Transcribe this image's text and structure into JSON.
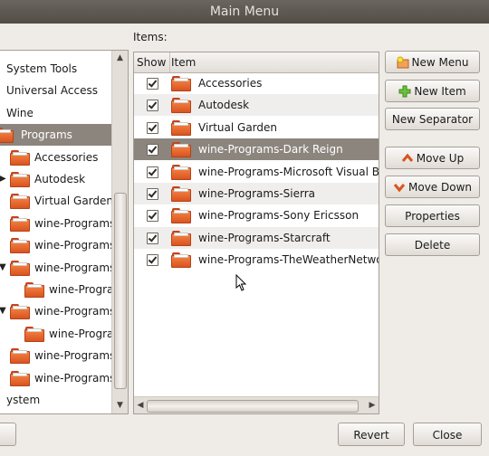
{
  "window": {
    "title": "Main Menu"
  },
  "items_label": "Items:",
  "tree": {
    "rows": [
      {
        "label": "System Tools",
        "indent": 0,
        "folder": false,
        "arrow": "",
        "selected": false
      },
      {
        "label": "Universal Access",
        "indent": 0,
        "folder": false,
        "arrow": "",
        "selected": false
      },
      {
        "label": "Wine",
        "indent": 0,
        "folder": false,
        "arrow": "",
        "selected": false
      },
      {
        "label": "Programs",
        "indent": 0,
        "folder": true,
        "arrow": "",
        "selected": true
      },
      {
        "label": "Accessories",
        "indent": 1,
        "folder": true,
        "arrow": "",
        "selected": false
      },
      {
        "label": "Autodesk",
        "indent": 1,
        "folder": true,
        "arrow": "▶",
        "selected": false
      },
      {
        "label": "Virtual Garden",
        "indent": 1,
        "folder": true,
        "arrow": "",
        "selected": false
      },
      {
        "label": "wine-Programs",
        "indent": 1,
        "folder": true,
        "arrow": "",
        "selected": false
      },
      {
        "label": "wine-Programs",
        "indent": 1,
        "folder": true,
        "arrow": "",
        "selected": false
      },
      {
        "label": "wine-Programs",
        "indent": 1,
        "folder": true,
        "arrow": "▼",
        "selected": false
      },
      {
        "label": "wine-Programs",
        "indent": 2,
        "folder": true,
        "arrow": "",
        "selected": false
      },
      {
        "label": "wine-Programs",
        "indent": 1,
        "folder": true,
        "arrow": "▼",
        "selected": false
      },
      {
        "label": "wine-Programs",
        "indent": 2,
        "folder": true,
        "arrow": "",
        "selected": false
      },
      {
        "label": "wine-Programs",
        "indent": 1,
        "folder": true,
        "arrow": "",
        "selected": false
      },
      {
        "label": "wine-Programs",
        "indent": 1,
        "folder": true,
        "arrow": "",
        "selected": false
      },
      {
        "label": "ystem",
        "indent": 0,
        "folder": false,
        "arrow": "",
        "selected": false
      }
    ]
  },
  "list": {
    "headers": {
      "show": "Show",
      "item": "Item"
    },
    "rows": [
      {
        "label": "Accessories",
        "checked": true,
        "selected": false
      },
      {
        "label": "Autodesk",
        "checked": true,
        "selected": false
      },
      {
        "label": "Virtual Garden",
        "checked": true,
        "selected": false
      },
      {
        "label": "wine-Programs-Dark Reign",
        "checked": true,
        "selected": true
      },
      {
        "label": "wine-Programs-Microsoft Visual B",
        "checked": true,
        "selected": false
      },
      {
        "label": "wine-Programs-Sierra",
        "checked": true,
        "selected": false
      },
      {
        "label": "wine-Programs-Sony Ericsson",
        "checked": true,
        "selected": false
      },
      {
        "label": "wine-Programs-Starcraft",
        "checked": true,
        "selected": false
      },
      {
        "label": "wine-Programs-TheWeatherNetwo",
        "checked": true,
        "selected": false
      }
    ]
  },
  "buttons": {
    "new_menu": "New Menu",
    "new_item": "New Item",
    "new_separator": "New Separator",
    "move_up": "Move Up",
    "move_down": "Move Down",
    "properties": "Properties",
    "delete": "Delete",
    "revert": "Revert",
    "close": "Close"
  },
  "icons": {
    "new_menu": "new-folder-icon",
    "new_item": "plus-icon",
    "move_up": "arrow-up-icon",
    "move_down": "arrow-down-icon",
    "folder": "folder-icon"
  },
  "colors": {
    "selection": "#8c857d",
    "folder": "#e96a2e",
    "plus": "#4ea52a",
    "arrow": "#d9541f"
  }
}
